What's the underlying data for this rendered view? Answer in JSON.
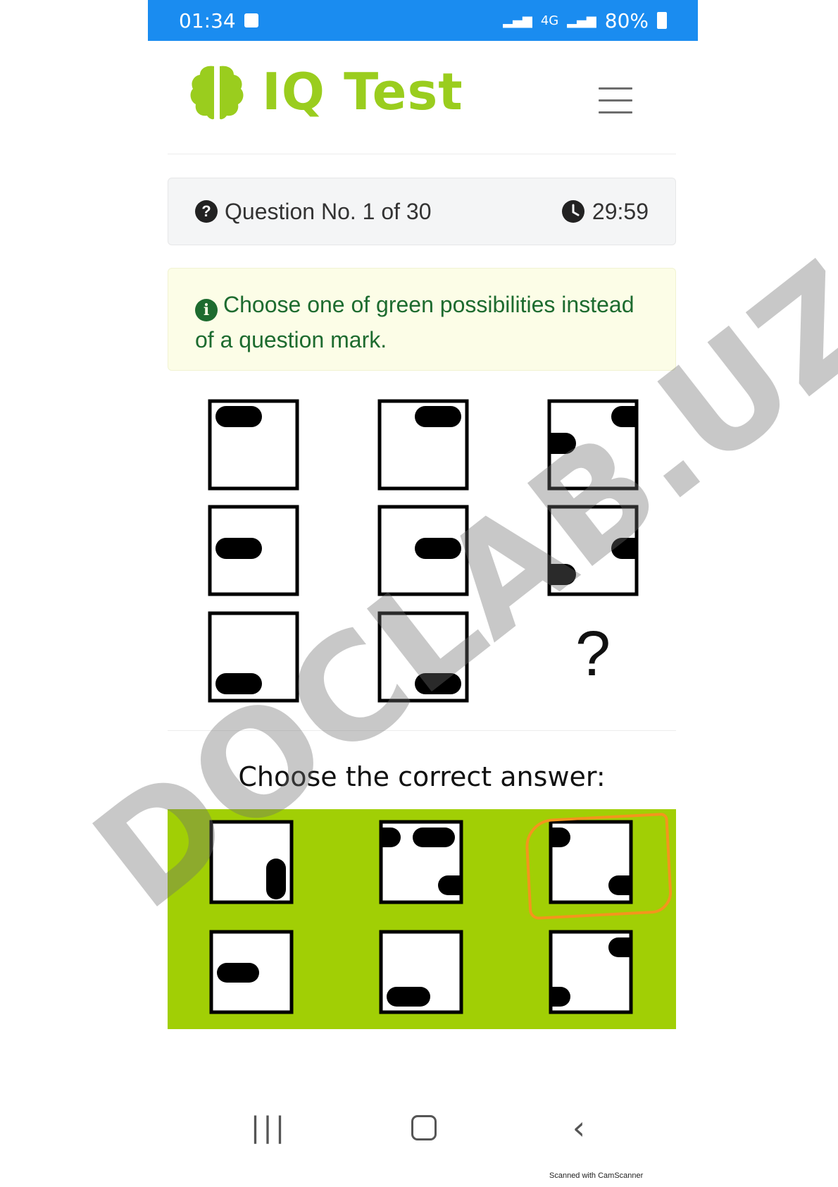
{
  "status_bar": {
    "time": "01:34",
    "network": "4G",
    "battery": "80%"
  },
  "header": {
    "logo_text": "IQ Test",
    "logo_icon": "brain-icon",
    "menu_icon": "hamburger-menu-icon"
  },
  "question_bar": {
    "question_label": "Question No. 1 of 30",
    "question_icon": "question-circle-icon",
    "timer": "29:59",
    "timer_icon": "clock-icon"
  },
  "instruction": {
    "icon": "info-circle-icon",
    "text": "Choose one of green possibilities instead of a question mark."
  },
  "puzzle": {
    "missing_symbol": "?",
    "cells": [
      [
        "bar-top-left",
        "bar-top-right",
        "caps-top-right-and-left-middle"
      ],
      [
        "bar-middle-left",
        "bar-middle-right",
        "caps-right-middle-and-left-lower"
      ],
      [
        "bar-bottom-left",
        "bar-bottom-right",
        "missing"
      ]
    ]
  },
  "answers": {
    "prompt": "Choose the correct answer:",
    "selected_index": 2,
    "options": [
      "vertical-bar-bottom-right",
      "caps-top-left-bar-top-right-cap-right-lower",
      "caps-left-top-and-right-bottom",
      "bar-middle-left",
      "bar-bottom-middle",
      "caps-right-top-and-left-lower"
    ],
    "highlight_color": "#f4951d",
    "background_color": "#a1cf05"
  },
  "nav_bar": {
    "recent_icon": "recent-apps-icon",
    "home_icon": "home-icon",
    "back_icon": "back-icon"
  },
  "watermark": "DOCLAB.UZ",
  "scanner_note": "Scanned with CamScanner"
}
